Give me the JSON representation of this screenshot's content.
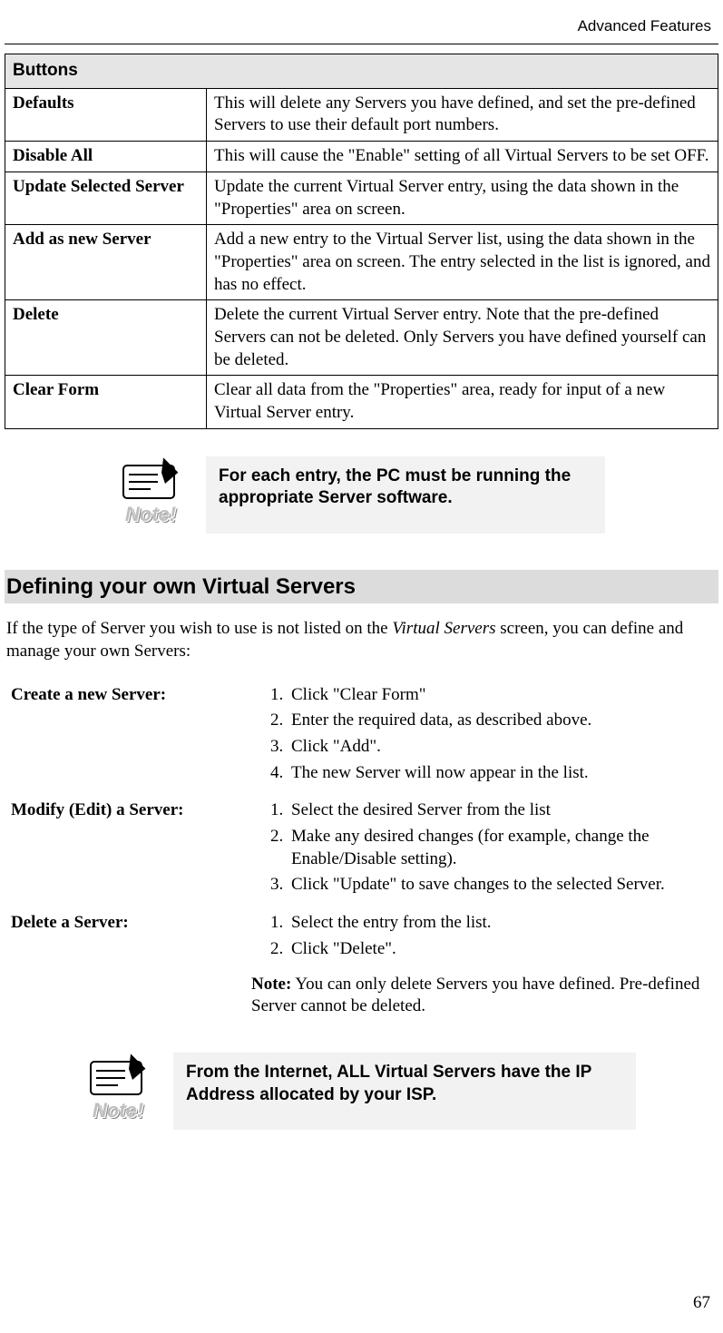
{
  "header": {
    "right": "Advanced Features"
  },
  "buttons_table": {
    "header": "Buttons",
    "rows": [
      {
        "label": "Defaults",
        "desc": "This will delete any Servers you have defined, and set the pre-defined Servers to use their default port numbers."
      },
      {
        "label": "Disable All",
        "desc": "This will cause the \"Enable\" setting of all Virtual Servers to be set OFF."
      },
      {
        "label": "Update Selected Server",
        "desc": "Update the current Virtual Server entry, using the data shown in the \"Properties\" area on screen."
      },
      {
        "label": "Add as new Server",
        "desc": "Add a new entry to the Virtual Server list, using the data shown in the \"Properties\" area on screen. The entry selected in the list is ignored, and has no effect."
      },
      {
        "label": "Delete",
        "desc": "Delete the current Virtual Server entry. Note that the pre-defined Servers can not be deleted. Only Servers you have defined yourself can be deleted."
      },
      {
        "label": "Clear Form",
        "desc": "Clear all data from the \"Properties\" area, ready for input of a new Virtual Server entry."
      }
    ]
  },
  "note1": {
    "icon_label": "Note!",
    "text": "For each entry, the PC must be running the appropriate Server software."
  },
  "section_heading": "Defining your own Virtual Servers",
  "intro": {
    "pre": "If the type of Server you wish to use is not listed on the ",
    "italic": "Virtual Servers",
    "post": " screen, you can define and manage your own Servers:"
  },
  "procedures": [
    {
      "title": "Create a new Server:",
      "steps": [
        "Click \"Clear Form\"",
        "Enter the required data, as described above.",
        "Click \"Add\".",
        "The new Server will now appear in the list."
      ]
    },
    {
      "title": "Modify (Edit) a Server:",
      "steps": [
        "Select the desired Server from the list",
        "Make any desired changes (for example, change the Enable/Disable setting).",
        "Click \"Update\" to save changes to the selected Server."
      ]
    },
    {
      "title": "Delete a Server:",
      "steps": [
        "Select the entry from the list.",
        "Click \"Delete\"."
      ],
      "note_label": "Note:",
      "note_text": "  You can only delete Servers you have defined. Pre-defined Server cannot be deleted."
    }
  ],
  "note2": {
    "icon_label": "Note!",
    "text": "From the Internet, ALL Virtual Servers have the IP Address allocated by your ISP."
  },
  "page_number": "67"
}
